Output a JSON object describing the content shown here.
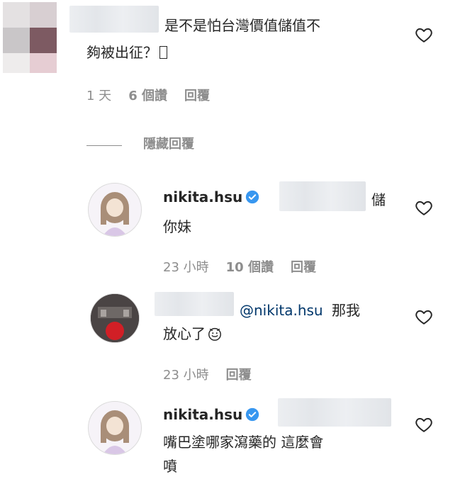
{
  "colors": {
    "text": "#262626",
    "meta": "#8e8e8e",
    "mention": "#00376b",
    "verified": "#3897f0"
  },
  "comment1": {
    "text_line1": "是不是怕台灣價值儲值不",
    "text_line2": "夠被出征？",
    "time": "1 天",
    "likes": "6 個讚",
    "reply": "回覆",
    "hide_replies": "隱藏回覆"
  },
  "reply1": {
    "username": "nikita.hsu",
    "text_prefix": "儲",
    "text_line2": "你妹",
    "time": "23 小時",
    "likes": "10 個讚",
    "reply": "回覆"
  },
  "reply2": {
    "mention": "@nikita.hsu",
    "text_tail": "那我",
    "text_line2": "放心了",
    "time": "23 小時",
    "reply": "回覆"
  },
  "reply3": {
    "username": "nikita.hsu",
    "text_line1": "嘴巴塗哪家瀉藥的 這麼會",
    "text_line2": "噴"
  },
  "icons": {
    "like": "heart-outline-icon",
    "verified": "verified-badge-icon",
    "emoji": "smiley-icon"
  }
}
